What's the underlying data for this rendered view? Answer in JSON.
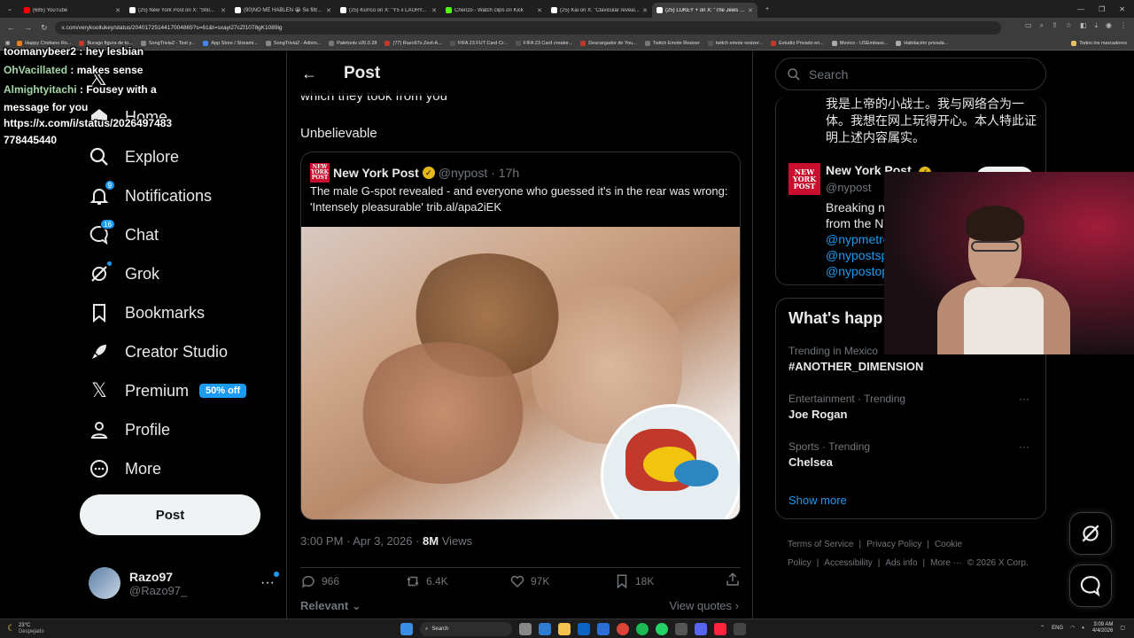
{
  "browser": {
    "tabs": [
      {
        "title": "(685) YouTube",
        "color": "#ff0000",
        "active": false
      },
      {
        "title": "(25) New York Post on X: \"Shil...",
        "color": "#ffffff",
        "active": false
      },
      {
        "title": "(90)NO ME HABLEN 😭 Se filtr...",
        "color": "#ffffff",
        "active": false
      },
      {
        "title": "(25) Kurrco on X: \"Y5 x LAURY...",
        "color": "#ffffff",
        "active": false
      },
      {
        "title": "Chenzo - Watch clips on Kick",
        "color": "#53fc18",
        "active": false
      },
      {
        "title": "(25) Kai on X: \"Clavicular reveal...",
        "color": "#ffffff",
        "active": false
      },
      {
        "title": "(25) LUKEY + on X: \"The Jews t...",
        "color": "#ffffff",
        "active": true
      }
    ],
    "url": "x.com/verykoollukey/status/2040172514417004865?s=61&t=sxayi27cZf1078gK1089lg",
    "bookmarks": [
      "Happy Cristiano Ro...",
      "Burago figura de to...",
      "SongTrivia2 - Test y...",
      "App Store / Streami...",
      "SongTrivia2 - Adivin...",
      "Paletools v26.0.28",
      "(77) Razo97s Zest-A...",
      "FIFA 23 FUT Card Cr...",
      "FIFA 23 Card creator...",
      "Descargador de You...",
      "Twitch Emote Resizer",
      "twitch emote resizer...",
      "Estudio Privado en...",
      "Mexico - USEmbass...",
      "Habitación privada..."
    ],
    "bookmarks_folder": "Todos los marcadores"
  },
  "chat_overlay": {
    "partial_line": "toomanybeer2 : hey lesbian",
    "lines": [
      {
        "user": "OhVacillated",
        "msg": " : makes sense"
      },
      {
        "user": "Almightyitachi",
        "msg": " : Fousey with a"
      }
    ],
    "wrap": "message for you",
    "link1": "https://x.com/i/status/2026497483",
    "link2": "778445440"
  },
  "nav": {
    "home": "Home",
    "explore": "Explore",
    "notifications": "Notifications",
    "notifications_badge": "9",
    "chat": "Chat",
    "chat_badge": "16",
    "grok": "Grok",
    "bookmarks": "Bookmarks",
    "creator_studio": "Creator Studio",
    "premium": "Premium",
    "premium_badge": "50% off",
    "profile": "Profile",
    "more": "More",
    "post_button": "Post"
  },
  "account": {
    "name": "Razo97",
    "handle": "@Razo97_"
  },
  "main": {
    "header_title": "Post",
    "text_line1": "which they took from you",
    "text_line2": "Unbelievable",
    "quote": {
      "logo_text": "NEW YORK POST",
      "name": "New York Post",
      "handle": "@nypost",
      "time": "· 17h",
      "text": "The male G-spot revealed - and everyone who guessed it's in the rear was wrong: 'Intensely pleasurable' trib.al/apa2iEK"
    },
    "timestamp": "3:00 PM · Apr 3, 2026 · ",
    "views_count": "8M",
    "views_label": " Views",
    "replies": "966",
    "reposts": "6.4K",
    "likes": "97K",
    "bookmarks": "18K",
    "relevant": "Relevant",
    "view_quotes": "View quotes"
  },
  "right": {
    "search_placeholder": "Search",
    "chinese_bio": "我是上帝的小战士。我与网络合为一体。我想在网上玩得开心。本人特此证明上述内容属实。",
    "card_name": "New York Post",
    "card_handle": "@nypost",
    "card_bio_start": "Breaking ne",
    "card_bio_line2": "from the NY",
    "card_links": [
      "@nypmetro",
      "@nypostsp",
      "@nypostop"
    ],
    "whats_happening": "What's happ",
    "trends": [
      {
        "context": "Trending in Mexico",
        "name": "#ANOTHER_DIMENSION"
      },
      {
        "context": "Entertainment · Trending",
        "name": "Joe Rogan"
      },
      {
        "context": "Sports · Trending",
        "name": "Chelsea"
      }
    ],
    "show_more": "Show more",
    "footer": [
      "Terms of Service",
      "|",
      "Privacy Policy",
      "|",
      "Cookie Policy",
      "|",
      "Accessibility",
      "|",
      "Ads info",
      "|",
      "More ···",
      "© 2026 X Corp."
    ]
  },
  "taskbar": {
    "temp": "23°C",
    "weather": "Despejado",
    "search": "Search",
    "lang": "ENG",
    "time": "3:09 AM",
    "date": "4/4/2026"
  },
  "colors": {
    "accent": "#1d9bf0",
    "nyp_red": "#c8102e",
    "background": "#000000"
  }
}
